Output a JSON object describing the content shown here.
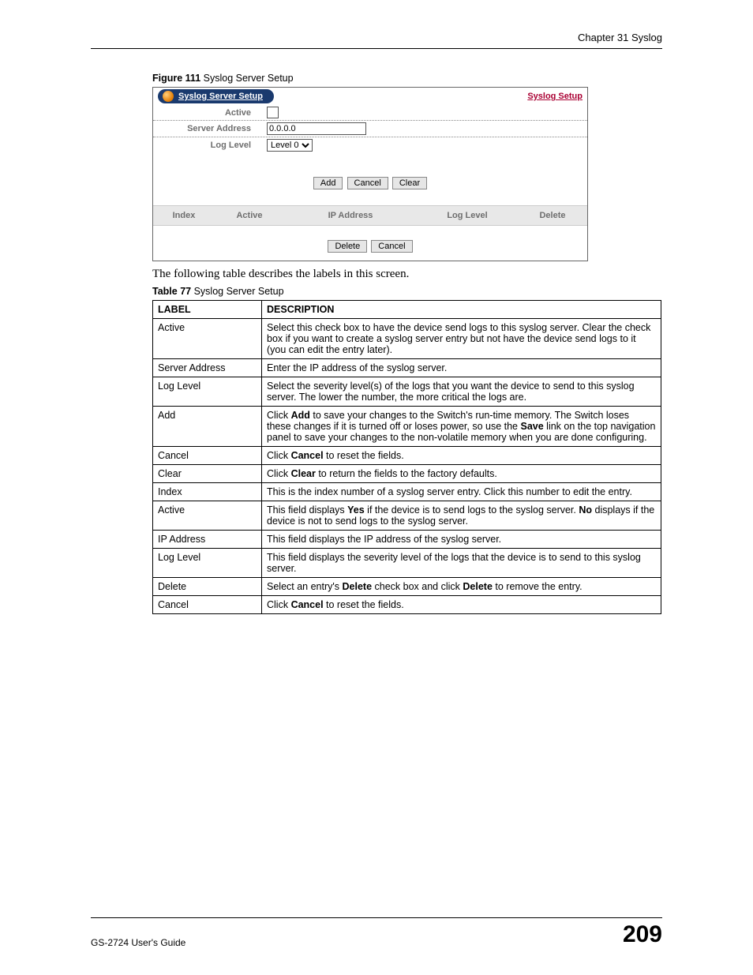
{
  "header": {
    "chapter": "Chapter 31 Syslog"
  },
  "figure": {
    "caption_bold": "Figure 111",
    "caption_rest": "   Syslog Server Setup",
    "title": "Syslog Server Setup",
    "link": "Syslog Setup",
    "rows": {
      "active_label": "Active",
      "server_label": "Server Address",
      "server_value": "0.0.0.0",
      "loglevel_label": "Log Level",
      "loglevel_value": "Level 0"
    },
    "buttons": {
      "add": "Add",
      "cancel": "Cancel",
      "clear": "Clear",
      "delete": "Delete"
    },
    "grid": {
      "index": "Index",
      "active": "Active",
      "ip": "IP Address",
      "loglevel": "Log Level",
      "delete": "Delete"
    }
  },
  "body_text": "The following table describes the labels in this screen.",
  "table": {
    "caption_bold": "Table 77",
    "caption_rest": "   Syslog Server Setup",
    "head_label": "LABEL",
    "head_desc": "DESCRIPTION",
    "rows": [
      {
        "label": "Active",
        "desc": "Select this check box to have the device send logs to this syslog server. Clear the check box if you want to create a syslog server entry but not have the device send logs to it (you can edit the entry later)."
      },
      {
        "label": "Server Address",
        "desc": "Enter the IP address of the syslog server."
      },
      {
        "label": "Log Level",
        "desc": "Select the severity level(s) of the logs that you want the device to send to this syslog server. The lower the number, the more critical the logs are."
      },
      {
        "label": "Add",
        "desc_html": "Click <b>Add</b> to save your changes to the Switch's run-time memory. The Switch loses these changes if it is turned off or loses power, so use the <b>Save</b> link on the top navigation panel to save your changes to the non-volatile memory when you are done configuring."
      },
      {
        "label": "Cancel",
        "desc_html": "Click <b>Cancel</b> to reset the fields."
      },
      {
        "label": "Clear",
        "desc_html": "Click <b>Clear</b> to return the fields to the factory defaults."
      },
      {
        "label": "Index",
        "desc": "This is the index number of a syslog server entry. Click this number to edit the entry."
      },
      {
        "label": "Active",
        "desc_html": "This field displays <b>Yes</b> if the device is to send logs to the syslog server. <b>No</b> displays if the device is not to send logs to the syslog server."
      },
      {
        "label": "IP Address",
        "desc": "This field displays the IP address of the syslog server."
      },
      {
        "label": "Log Level",
        "desc": "This field displays the severity level of the logs that the device is to send to this syslog server."
      },
      {
        "label": "Delete",
        "desc_html": "Select an entry's <b>Delete</b> check box and click <b>Delete</b> to remove the entry."
      },
      {
        "label": "Cancel",
        "desc_html": "Click <b>Cancel</b> to reset the fields."
      }
    ]
  },
  "footer": {
    "guide": "GS-2724 User's Guide",
    "page": "209"
  }
}
